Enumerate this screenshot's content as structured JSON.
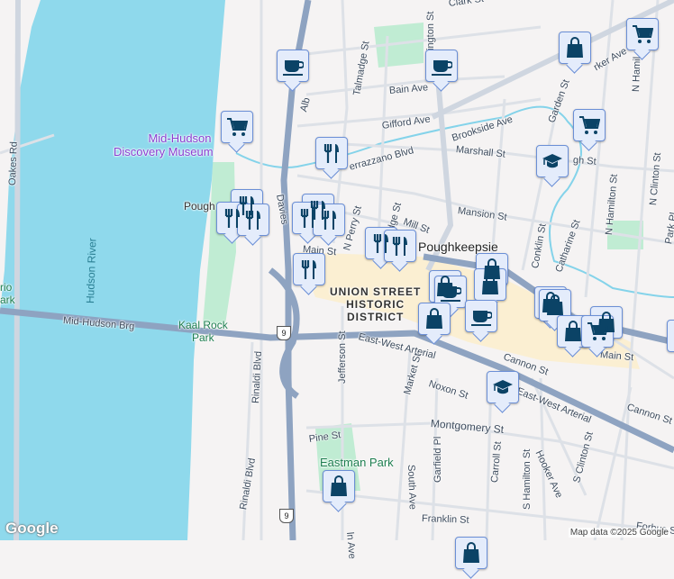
{
  "streets": {
    "clark": "Clark St",
    "washington": "ington St",
    "talmadge": "Talmadge St",
    "bain": "Bain Ave",
    "gifford": "Gifford Ave",
    "brookside": "Brookside Ave",
    "marshall": "Marshall St",
    "verrazzano": "errazzano Blvd",
    "garden": "Garden St",
    "parker": "rker Ave",
    "n_hamilton_1": "N Hamil",
    "n_hamilton_2": "N Hamilton St",
    "n_clinton": "N Clinton St",
    "park_pl": "Park Pl",
    "mansion": "Mansion St",
    "mill": "Mill St",
    "bridge_st": "dge St",
    "n_perry": "N Perry St",
    "conklin": "Conklin St",
    "catharine": "Catharine St",
    "high": "gh St",
    "main_1": "Main St",
    "main_2": "Main St",
    "davies": "Davies",
    "albany": "Alb",
    "oakes": "Oakes Rd",
    "bridge": "Mid-Hudson Brg",
    "arterial_1": "East-West Arterial",
    "arterial_2": "East-West Arterial",
    "cannon_1": "Cannon St",
    "cannon_2": "Cannon St",
    "noxon": "Noxon St",
    "montgomery": "Montgomery St",
    "market": "Market St",
    "jefferson": "Jefferson St",
    "rinaldi_1": "Rinaldi Blvd",
    "rinaldi_2": "Rinaldi Blvd",
    "pine": "Pine St",
    "south_ave": "South Ave",
    "garfield": "Garfield Pl",
    "carroll": "Carroll St",
    "s_hamilton": "S Hamilton St",
    "hooker": "Hooker Ave",
    "s_clinton": "S Clinton St",
    "franklin": "Franklin St",
    "forbus": "Forbus St",
    "lincoln": "ln Ave"
  },
  "places": {
    "city": "Poughkeepsie",
    "station": "Pough",
    "museum_1": "Mid-Hudson",
    "museum_2": "Discovery Museum",
    "river": "Hudson River",
    "kaal_rock_1": "Kaal Rock",
    "kaal_rock_2": "Park",
    "left_park_1": "rio",
    "left_park_2": "ark",
    "eastman": "Eastman Park",
    "district_1": "UNION STREET",
    "district_2": "HISTORIC",
    "district_3": "DISTRICT"
  },
  "route_shield": "9",
  "attribution": "Map data ©2025 Google",
  "logo": "Google",
  "marker_types": [
    "coffee-icon",
    "shopping-cart-icon",
    "shopping-bag-icon",
    "restaurant-icon",
    "school-icon"
  ],
  "colors": {
    "water": "#8fd9ec",
    "park": "#c0ecd3",
    "highway": "#8ea3c1",
    "marker_fill": "#e4ecfb",
    "marker_icon": "#0b4366",
    "district": "#fbefd2"
  }
}
